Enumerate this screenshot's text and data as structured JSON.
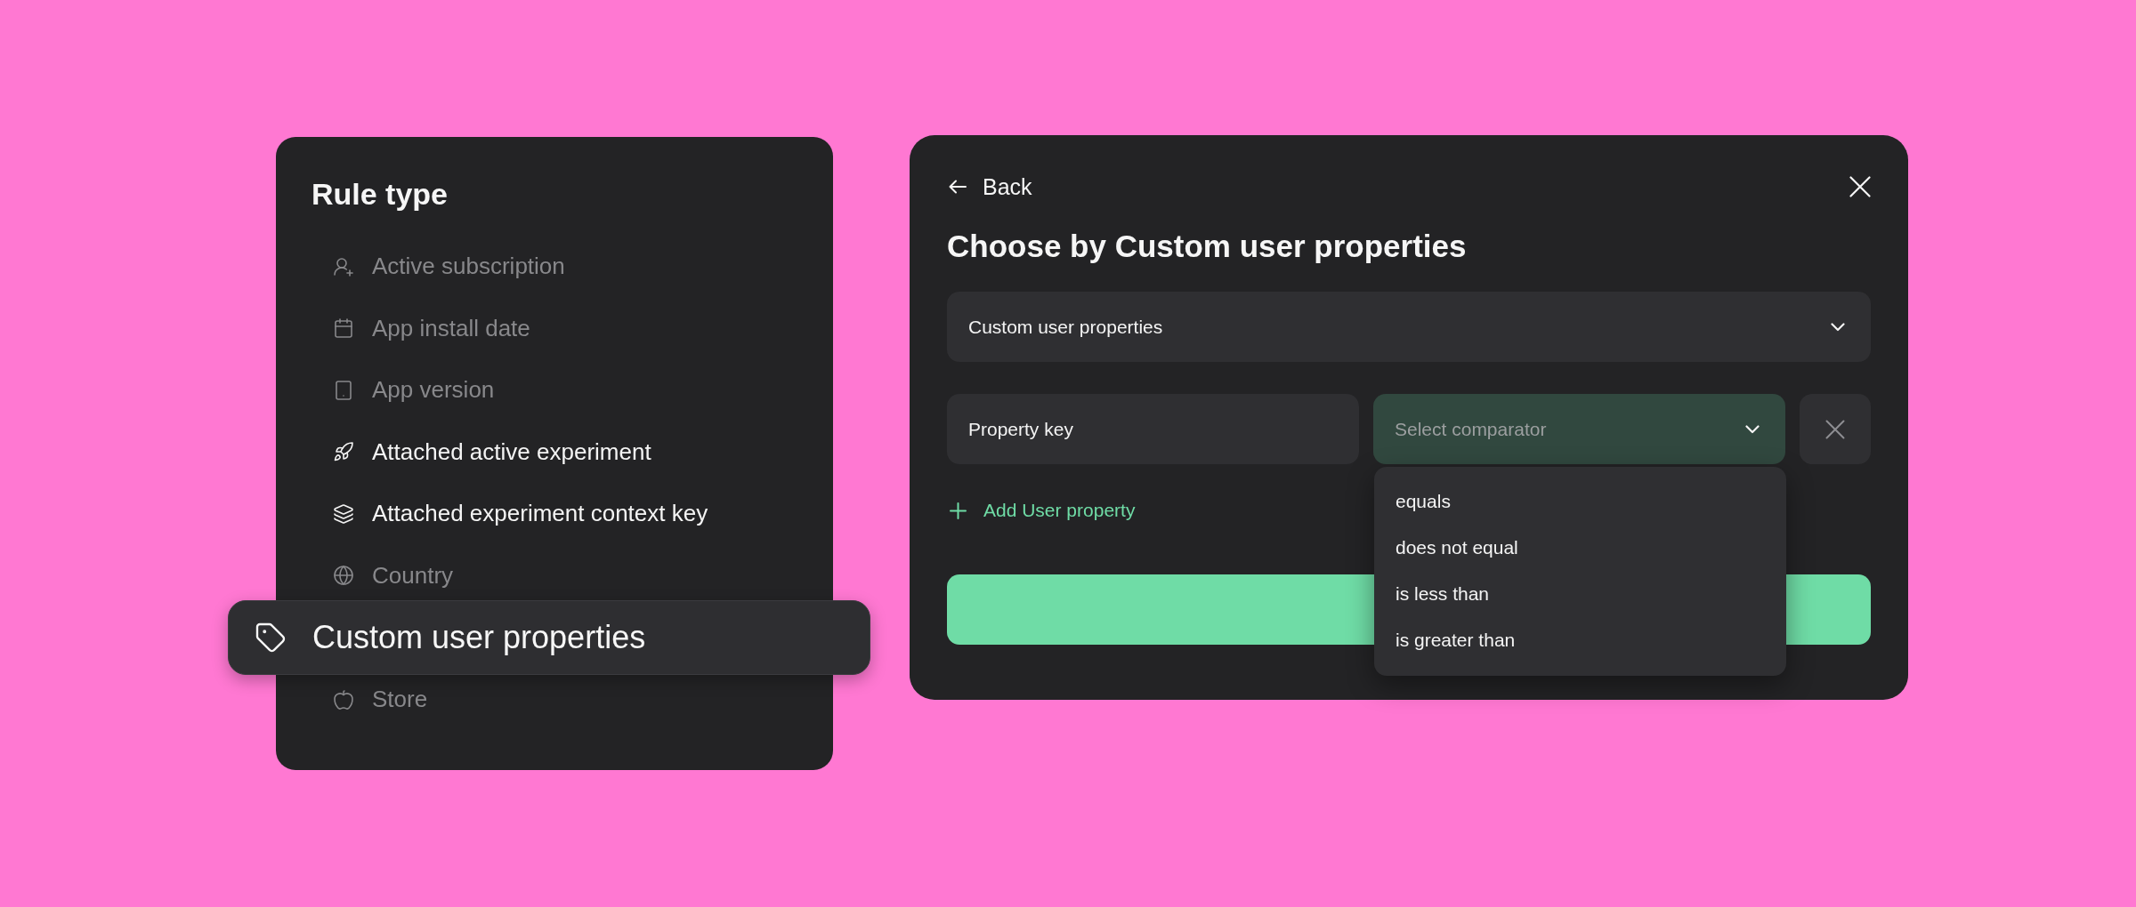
{
  "rule_panel": {
    "title": "Rule type",
    "items": [
      {
        "label": "Active subscription",
        "disabled": true,
        "selected": false
      },
      {
        "label": "App install date",
        "disabled": true,
        "selected": false
      },
      {
        "label": "App version",
        "disabled": true,
        "selected": false
      },
      {
        "label": "Attached active experiment",
        "disabled": false,
        "selected": false
      },
      {
        "label": "Attached experiment context key",
        "disabled": false,
        "selected": false
      },
      {
        "label": "Country",
        "disabled": true,
        "selected": false
      },
      {
        "label": "Custom user properties",
        "disabled": false,
        "selected": true
      },
      {
        "label": "Store",
        "disabled": true,
        "selected": false
      }
    ]
  },
  "dialog": {
    "back": "Back",
    "title": "Choose by Custom user properties",
    "property_type": {
      "value": "Custom user properties"
    },
    "condition": {
      "property_key": {
        "value": "Property key"
      },
      "comparator": {
        "placeholder": "Select comparator",
        "expanded": true,
        "options": [
          "equals",
          "does not equal",
          "is less than",
          "is greater than"
        ]
      }
    },
    "add_link": "Add User property"
  }
}
